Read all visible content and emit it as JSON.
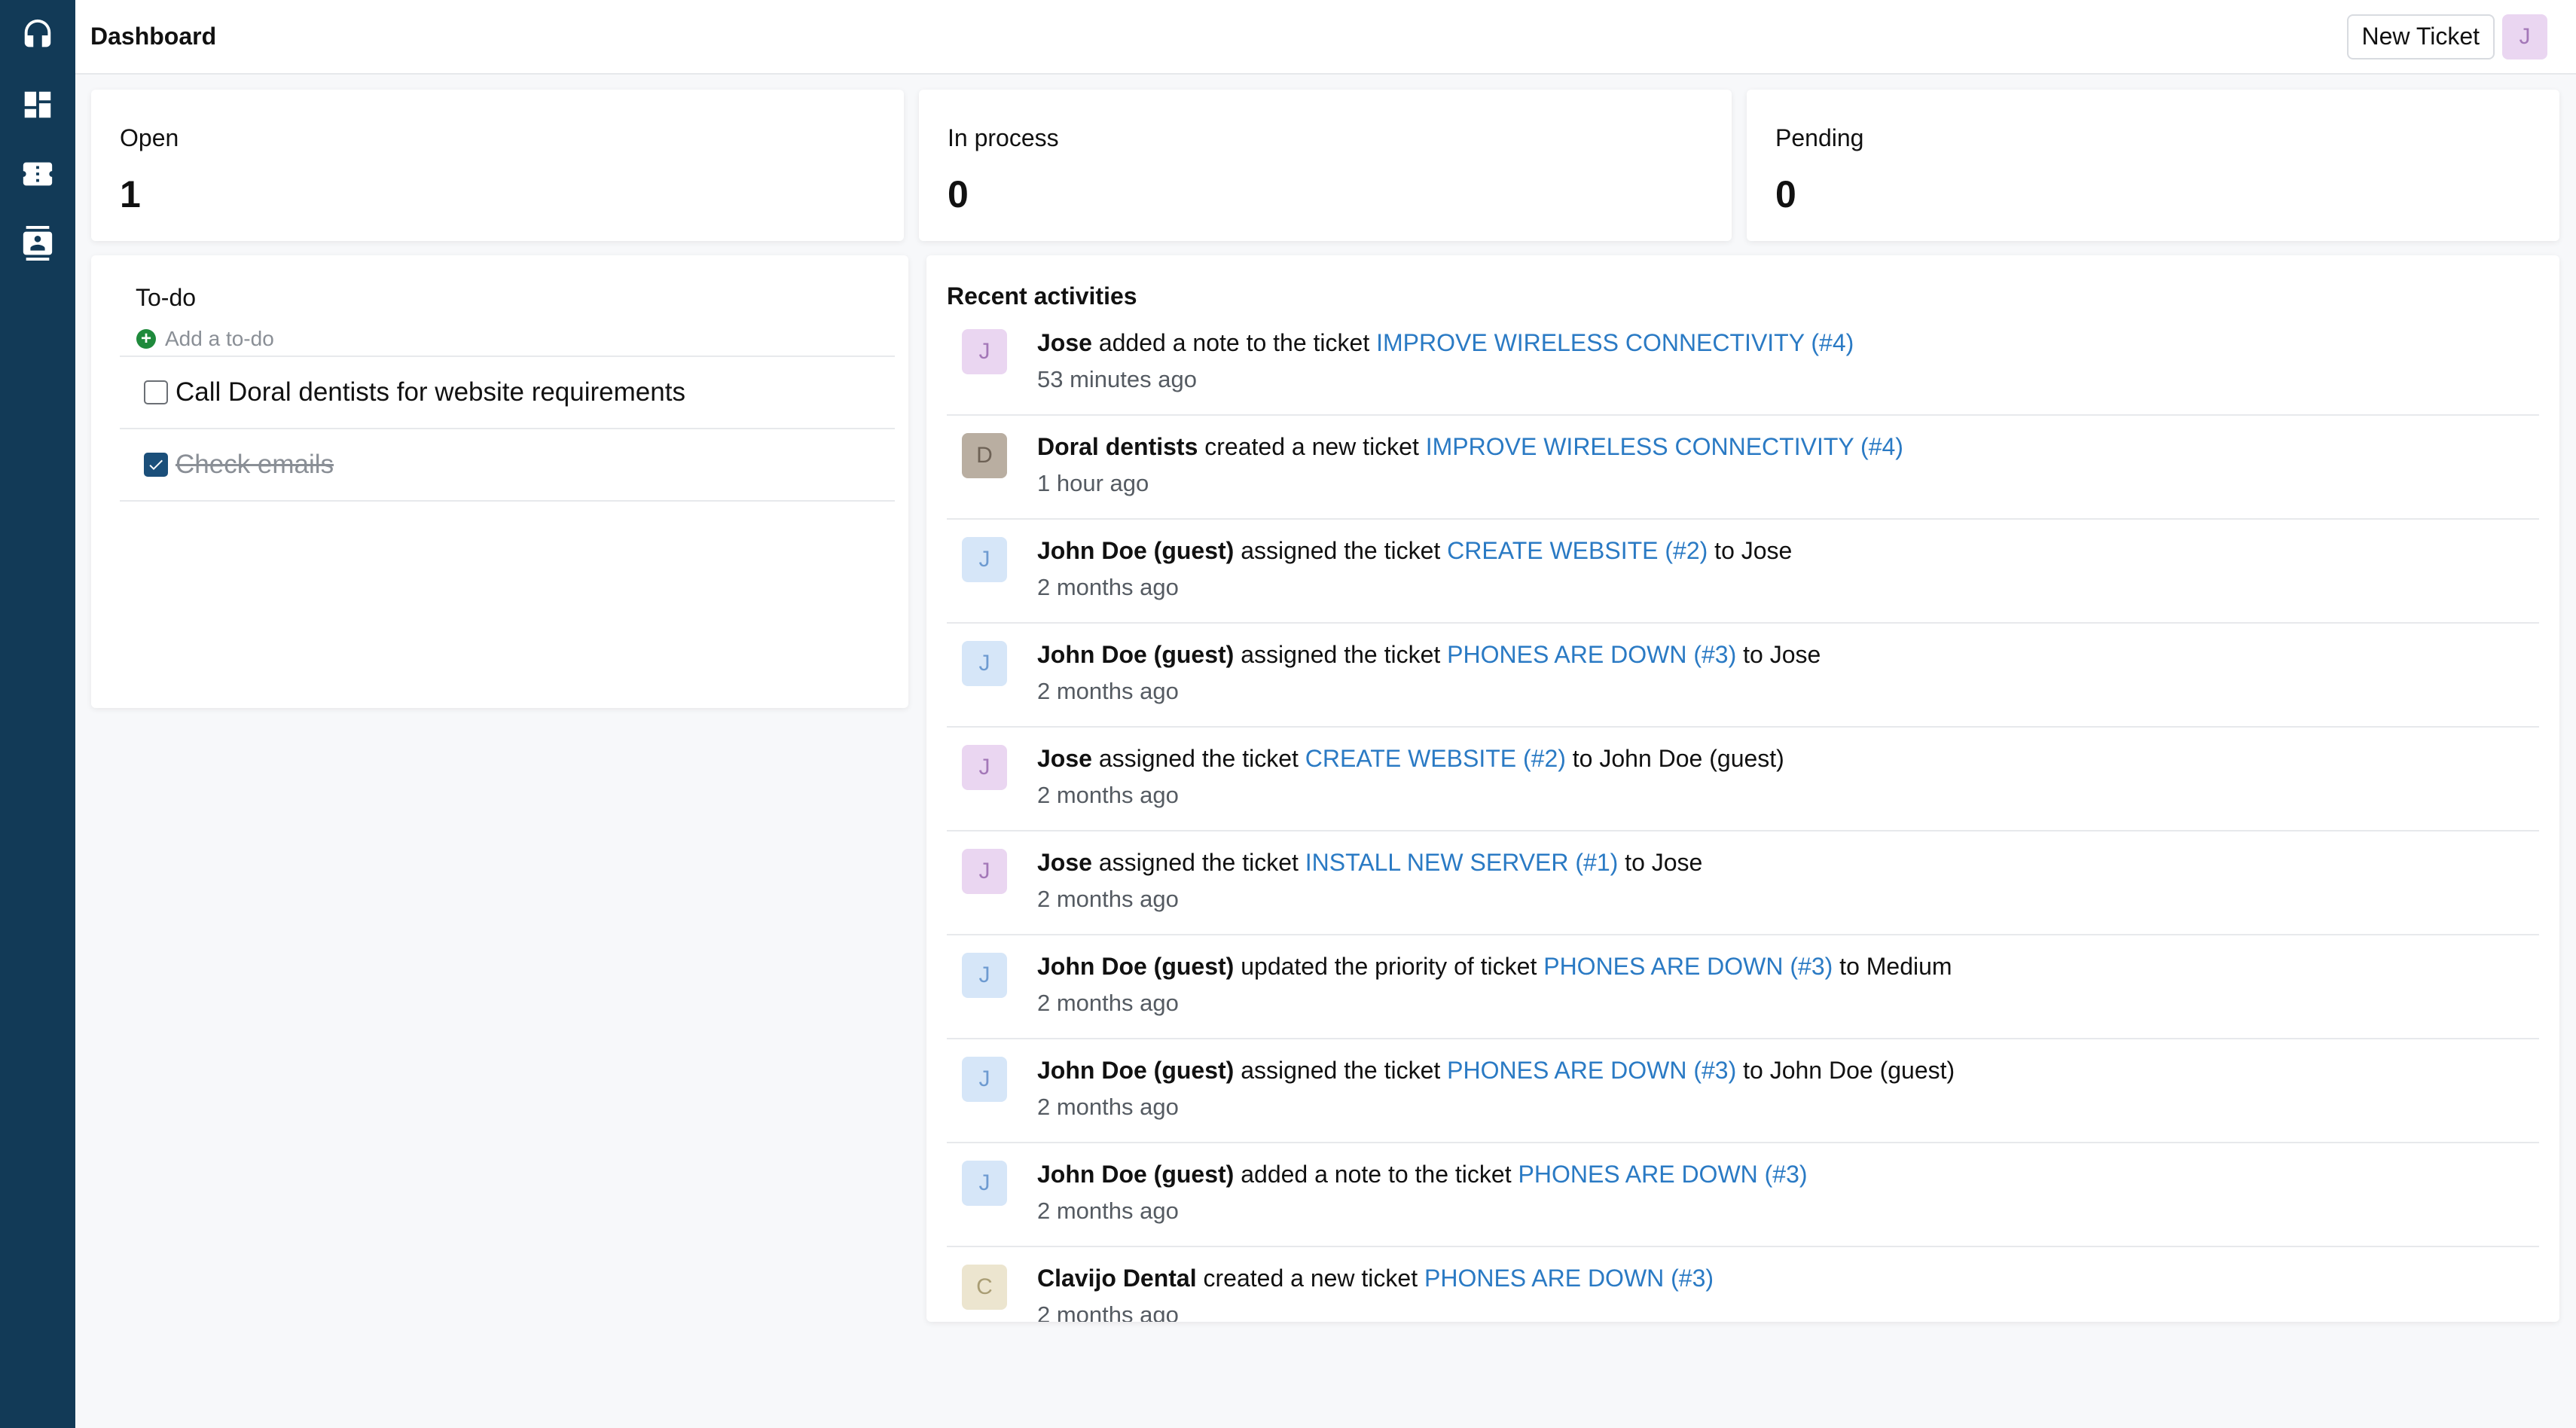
{
  "header": {
    "title": "Dashboard",
    "new_ticket_label": "New Ticket",
    "user_initial": "J"
  },
  "sidebar": {
    "items": [
      {
        "icon": "headset-icon"
      },
      {
        "icon": "dashboard-icon"
      },
      {
        "icon": "ticket-icon"
      },
      {
        "icon": "contacts-icon"
      }
    ]
  },
  "stats": [
    {
      "label": "Open",
      "value": "1"
    },
    {
      "label": "In process",
      "value": "0"
    },
    {
      "label": "Pending",
      "value": "0"
    }
  ],
  "todo": {
    "title": "To-do",
    "add_placeholder": "Add a to-do",
    "items": [
      {
        "text": "Call Doral dentists for website requirements",
        "done": false
      },
      {
        "text": "Check emails",
        "done": true
      }
    ]
  },
  "activities": {
    "title": "Recent activities",
    "items": [
      {
        "initial": "J",
        "actor": "Jose",
        "action": "added a note to the ticket",
        "ticket": "IMPROVE WIRELESS CONNECTIVITY (#4)",
        "suffix": "",
        "time": "53 minutes ago"
      },
      {
        "initial": "D",
        "actor": "Doral dentists",
        "action": "created a new ticket",
        "ticket": "IMPROVE WIRELESS CONNECTIVITY (#4)",
        "suffix": "",
        "time": "1 hour ago"
      },
      {
        "initial": "J",
        "actor": "John Doe (guest)",
        "action": "assigned the ticket",
        "ticket": "CREATE WEBSITE (#2)",
        "suffix": "to Jose",
        "time": "2 months ago"
      },
      {
        "initial": "J",
        "actor": "John Doe (guest)",
        "action": "assigned the ticket",
        "ticket": "PHONES ARE DOWN (#3)",
        "suffix": "to Jose",
        "time": "2 months ago"
      },
      {
        "initial": "J",
        "actor": "Jose",
        "action": "assigned the ticket",
        "ticket": "CREATE WEBSITE (#2)",
        "suffix": "to John Doe (guest)",
        "time": "2 months ago"
      },
      {
        "initial": "J",
        "actor": "Jose",
        "action": "assigned the ticket",
        "ticket": "INSTALL NEW SERVER (#1)",
        "suffix": "to Jose",
        "time": "2 months ago"
      },
      {
        "initial": "J",
        "actor": "John Doe (guest)",
        "action": "updated the priority of ticket",
        "ticket": "PHONES ARE DOWN (#3)",
        "suffix": "to Medium",
        "time": "2 months ago"
      },
      {
        "initial": "J",
        "actor": "John Doe (guest)",
        "action": "assigned the ticket",
        "ticket": "PHONES ARE DOWN (#3)",
        "suffix": "to John Doe (guest)",
        "time": "2 months ago"
      },
      {
        "initial": "J",
        "actor": "John Doe (guest)",
        "action": "added a note to the ticket",
        "ticket": "PHONES ARE DOWN (#3)",
        "suffix": "",
        "time": "2 months ago"
      },
      {
        "initial": "C",
        "actor": "Clavijo Dental",
        "action": "created a new ticket",
        "ticket": "PHONES ARE DOWN (#3)",
        "suffix": "",
        "time": "2 months ago"
      }
    ]
  },
  "colors": {
    "sidebar": "#123a57",
    "link": "#2a7ac4",
    "add_icon": "#1f8a3c",
    "checkbox": "#1b4f7a"
  }
}
